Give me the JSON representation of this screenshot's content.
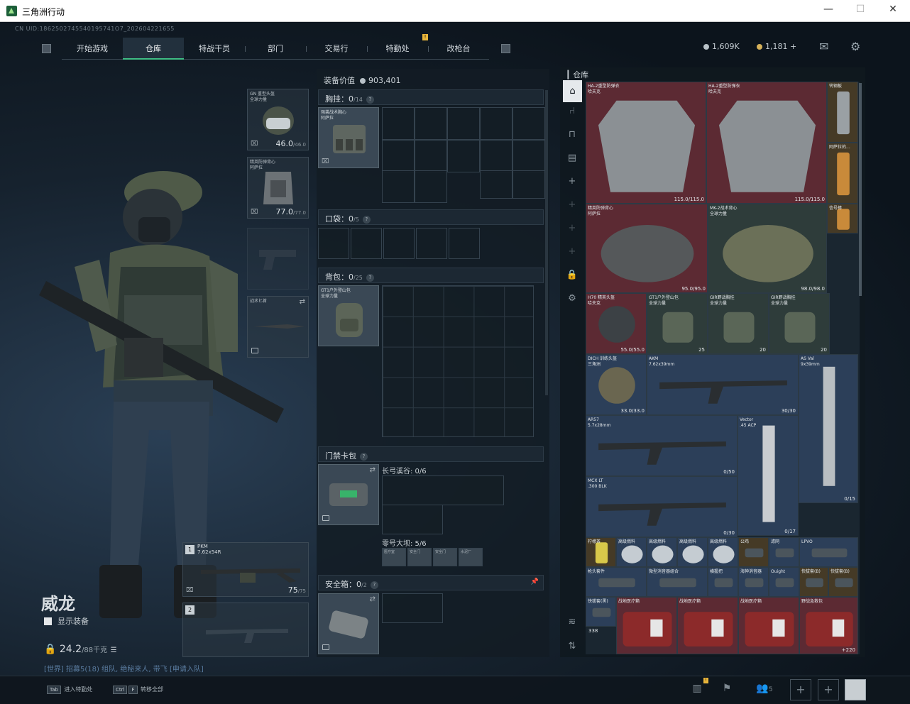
{
  "window": {
    "title": "三角洲行动",
    "controls": [
      "—",
      "☐",
      "✕"
    ]
  },
  "header": {
    "uid": "CN UID:1862502745540195741O7_202604221655",
    "nav": [
      "开始游戏",
      "仓库",
      "特战干员",
      "部门",
      "交易行",
      "特勤处",
      "改枪台"
    ],
    "active_tab": "仓库",
    "currency": [
      {
        "value": "1,609K",
        "color": "#b9c2c8"
      },
      {
        "value": "1,181 +",
        "color": "#d6b25a"
      }
    ],
    "icons": [
      "mail-icon",
      "gear-icon"
    ]
  },
  "operator": {
    "name": "威龙",
    "show_equipment": "显示装备",
    "weight": "24.2",
    "weight_max": "/88千克",
    "recruit": "[世界] 招募5(18) 组队, 绝秘来人, 带飞 [申请入队]"
  },
  "gear_slots": {
    "helmet": {
      "name": "GN 重型头盔\n全球力量",
      "dur": "46.0",
      "max": "/46.0"
    },
    "armor": {
      "name": "精英防弹背心\n阿萨拉",
      "dur": "77.0",
      "max": "/77.0"
    },
    "melee": {
      "name": "战术匕首"
    },
    "primary": {
      "num": "1",
      "name": "PKM\n7.62x54R",
      "ammo": "75",
      "ammo_max": "/75"
    },
    "secondary": {
      "num": "2"
    }
  },
  "equipment": {
    "value_label": "装备价值",
    "value": "903,401",
    "chest": {
      "label": "胸挂：",
      "count": "0",
      "max": "/14",
      "item": "强袭战术胸心\n阿萨拉"
    },
    "pocket": {
      "label": "口袋：",
      "count": "0",
      "max": "/5"
    },
    "backpack": {
      "label": "背包：",
      "count": "0",
      "max": "/25",
      "item": "GT1户外登山包\n全球力量"
    },
    "keycard": {
      "label": "门禁卡包",
      "map1": "长弓溪谷: 0/6",
      "map2": "零号大坝: 5/6",
      "cards": [
        "医疗室",
        "安全门",
        "安全门",
        "水泥厂"
      ]
    },
    "safebox": {
      "label": "安全箱：",
      "count": "0",
      "max": "/2"
    }
  },
  "warehouse": {
    "label": "仓库",
    "items": [
      {
        "name": "HA-2重型防弹衣\n哈夫克",
        "dur": "115.0/115.0"
      },
      {
        "name": "HA-2重型防弹衣\n哈夫克",
        "dur": "115.0/115.0"
      },
      {
        "name": "钨钢板"
      },
      {
        "name": "阿萨拉的..."
      },
      {
        "name": "精英防弹背心\n阿萨拉",
        "dur": "95.0/95.0"
      },
      {
        "name": "MK-2战术背心\n全球力量",
        "dur": "98.0/98.0"
      },
      {
        "name": "信号棒"
      },
      {
        "name": "H70 精英头盔\n哈夫克",
        "dur": "55.0/55.0"
      },
      {
        "name": "GT1户外登山包\n全球力量",
        "cnt": "25"
      },
      {
        "name": "GIR野战胸挂\n全球力量",
        "cnt": "20"
      },
      {
        "name": "GIR野战胸挂\n全球力量",
        "cnt": "20"
      },
      {
        "name": "DICH 训练头盔\n三角洲",
        "dur": "33.0/33.0"
      },
      {
        "name": "AKM\n7.62x39mm",
        "cnt": "30/30"
      },
      {
        "name": "AS Val\n9x39mm",
        "cnt": "0/15"
      },
      {
        "name": "AR57\n5.7x28mm",
        "cnt": "0/50"
      },
      {
        "name": "Vector\n.45 ACP",
        "cnt": "0/17"
      },
      {
        "name": "MCX LT\n.300 BLK",
        "cnt": "0/30"
      },
      {
        "name": "柠檬茶"
      },
      {
        "name": "高级燃料"
      },
      {
        "name": "高级燃料"
      },
      {
        "name": "高级燃料"
      },
      {
        "name": "高级燃料"
      },
      {
        "name": "公鸡"
      },
      {
        "name": "滤网"
      },
      {
        "name": "LPVO"
      },
      {
        "name": "枪头套件"
      },
      {
        "name": "微型消音器组合"
      },
      {
        "name": "横握把"
      },
      {
        "name": "海神消音器"
      },
      {
        "name": "Ouight"
      },
      {
        "name": "快拔套(B)"
      },
      {
        "name": "快拔套(B)"
      },
      {
        "name": "快拔套(黑)"
      },
      {
        "name": "战地医疗箱"
      },
      {
        "name": "战地医疗箱"
      },
      {
        "name": "战地医疗箱"
      },
      {
        "name": "野战急救包",
        "cnt": "+220"
      }
    ],
    "count_tag": "338",
    "sidebar_icons": [
      "home-icon",
      "chair-icon",
      "table-icon",
      "shelf-icon",
      "plus-icon",
      "plus-icon",
      "plus-icon",
      "plus-icon",
      "lock-icon",
      "gear-icon",
      "layers-icon",
      "sort-icon"
    ]
  },
  "bottom": {
    "hint1_key": "Tab",
    "hint1": "进入特勤处",
    "hint2_key": "Ctrl",
    "hint2_key2": "F",
    "hint2": "转移全部",
    "party_count": "5"
  }
}
